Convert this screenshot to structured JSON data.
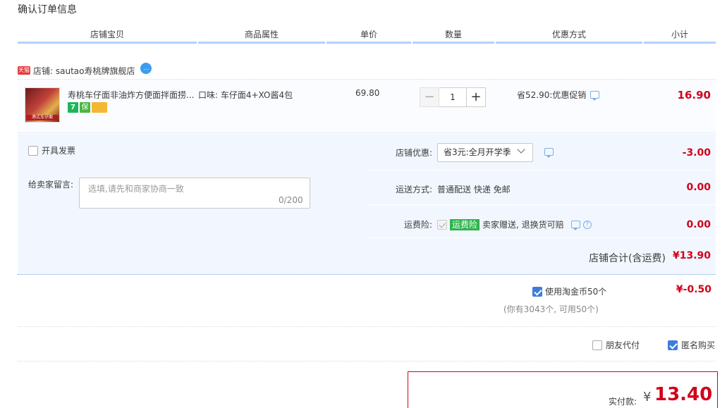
{
  "page": {
    "title": "确认订单信息"
  },
  "columns": [
    "店铺宝贝",
    "商品属性",
    "单价",
    "数量",
    "优惠方式",
    "小计"
  ],
  "shop": {
    "badge": "天猫",
    "name": "店铺: sautao寿桃牌旗舰店",
    "ww": "..."
  },
  "item": {
    "title": "寿桃车仔面非油炸方便面拌面捞...",
    "thumb_label": "港式车仔面",
    "services": [
      "7",
      "保"
    ],
    "attr": "口味: 车仔面4+XO酱4包",
    "price": "69.80",
    "quantity": "1",
    "qty_minus": "−",
    "qty_plus": "+",
    "promo": "省52.90:优惠促销",
    "subtotal": "16.90"
  },
  "invoice": {
    "label": "开具发票"
  },
  "message": {
    "label": "给卖家留言:",
    "placeholder": "选填,请先和商家协商一致",
    "count": "0/200"
  },
  "shop_discount": {
    "label": "店铺优惠:",
    "selected": "省3元:全月开学季",
    "amount": "-3.00"
  },
  "shipping": {
    "label": "运送方式:",
    "value": "普通配送 快递 免邮",
    "amount": "0.00"
  },
  "insurance": {
    "label": "运费险:",
    "badge": "运费险",
    "text": "卖家赠送, 退换货可赔",
    "help": "?",
    "amount": "0.00"
  },
  "shop_total": {
    "label": "店铺合计(含运费)",
    "value": "¥13.90"
  },
  "coins": {
    "label": "使用淘金币50个",
    "amount": "¥-0.50",
    "note": "(你有3043个, 可用50个)"
  },
  "options": {
    "friend_pay": "朋友代付",
    "anonymous": "匿名购买"
  },
  "payment": {
    "label": "实付款:",
    "currency": "¥",
    "amount": "13.40"
  }
}
